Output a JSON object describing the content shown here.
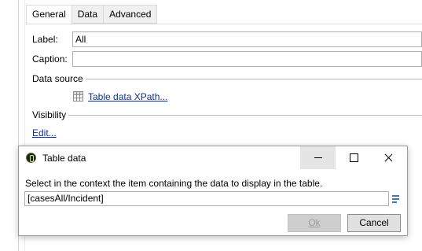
{
  "tabs": [
    {
      "label": "General",
      "active": true
    },
    {
      "label": "Data",
      "active": false
    },
    {
      "label": "Advanced",
      "active": false
    }
  ],
  "form": {
    "label_caption": "Label:",
    "label_value": "All",
    "caption_caption": "Caption:",
    "caption_value": "",
    "data_source_heading": "Data source",
    "data_source_link": "Table data XPath...",
    "visibility_heading": "Visibility",
    "visibility_link": "Edit..."
  },
  "dialog": {
    "title": "Table data",
    "message": "Select in the context the item containing the data to display in the table.",
    "input_value": "[casesAll/Incident]",
    "ok_label": "Ok",
    "ok_enabled": false,
    "cancel_label": "Cancel"
  },
  "icons": {
    "data_source": "table-grid-icon",
    "picker": "list-picker-icon",
    "app": "app-icon"
  }
}
